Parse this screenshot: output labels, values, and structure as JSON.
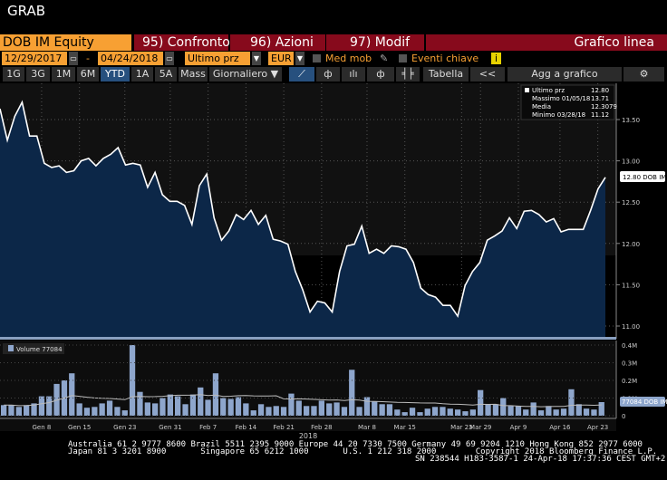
{
  "window": {
    "title": "GRAB"
  },
  "header": {
    "security": "DOB IM Equity",
    "compare": "95) Confronto",
    "actions": "96) Azioni",
    "edit": "97) Modif",
    "chart_type": "Grafico linea"
  },
  "controls": {
    "start_date": "12/29/2017",
    "dash": "-",
    "end_date": "04/24/2018",
    "field": "Ultimo prz",
    "currency": "EUR",
    "moving_avg": "Med mob",
    "key_events": "Eventi chiave",
    "info": "i"
  },
  "toolbar": {
    "periods": [
      "1G",
      "3G",
      "1M",
      "6M",
      "YTD",
      "1A",
      "5A",
      "Mass"
    ],
    "selected": "YTD",
    "frequency": "Giornaliero ▼",
    "table": "Tabella",
    "collapse": "<<",
    "add": "Agg a grafico",
    "settings": "⚙"
  },
  "legend": {
    "last_label": "Ultimo prz",
    "last": "12.80",
    "max_label": "Massimo 01/05/18",
    "max": "13.71",
    "mean_label": "Media",
    "mean": "12.3079",
    "min_label": "Minimo 03/28/18",
    "min": "11.12"
  },
  "price_tag": "12.80 DOB IM",
  "volume_legend": "Volume 77084",
  "volume_tag": "77084 DOB IM",
  "year_label": "2018",
  "footer": {
    "line1": "Australia 61 2 9777 8600 Brazil 5511 2395 9000 Europe 44 20 7330 7500 Germany 49 69 9204 1210 Hong Kong 852 2977 6000",
    "line2": "Japan 81 3 3201 8900       Singapore 65 6212 1000       U.S. 1 212 318 2000        Copyright 2018 Bloomberg Finance L.P.",
    "line3": "SN 238544 H183-3587-1 24-Apr-18 17:37:36 CEST GMT+2:00"
  },
  "colors": {
    "orange": "#f7a033",
    "red": "#870a1c",
    "fill": "#0c2748",
    "bar": "#8ea6cc"
  },
  "chart_data": [
    {
      "type": "area",
      "title": "DOB IM Equity Ultimo prz",
      "ylim": [
        10.9,
        13.9
      ],
      "yticks": [
        "11.00",
        "11.50",
        "12.00",
        "12.50",
        "13.00",
        "13.50"
      ],
      "values": [
        13.63,
        13.25,
        13.54,
        13.71,
        13.3,
        13.3,
        12.97,
        12.92,
        12.94,
        12.86,
        12.88,
        13.0,
        13.03,
        12.94,
        13.03,
        13.08,
        13.16,
        12.95,
        12.97,
        12.95,
        12.68,
        12.86,
        12.59,
        12.51,
        12.51,
        12.46,
        12.23,
        12.7,
        12.84,
        12.31,
        12.04,
        12.15,
        12.35,
        12.29,
        12.4,
        12.23,
        12.34,
        12.05,
        12.03,
        11.99,
        11.66,
        11.44,
        11.17,
        11.3,
        11.28,
        11.17,
        11.66,
        11.97,
        11.99,
        12.21,
        11.88,
        11.93,
        11.88,
        11.97,
        11.96,
        11.93,
        11.77,
        11.46,
        11.38,
        11.35,
        11.25,
        11.25,
        11.12,
        11.49,
        11.66,
        11.77,
        12.04,
        12.09,
        12.15,
        12.31,
        12.18,
        12.39,
        12.4,
        12.35,
        12.26,
        12.3,
        12.14,
        12.17,
        12.17,
        12.17,
        12.4,
        12.66,
        12.8
      ]
    },
    {
      "type": "bar",
      "title": "Volume",
      "ylim": [
        0,
        0.42
      ],
      "yticks": [
        "0",
        "0.1M",
        "0.2M",
        "0.3M",
        "0.4M"
      ],
      "unit": "M",
      "values": [
        0.06,
        0.06,
        0.05,
        0.06,
        0.07,
        0.11,
        0.11,
        0.18,
        0.2,
        0.24,
        0.07,
        0.045,
        0.05,
        0.07,
        0.085,
        0.05,
        0.03,
        0.4,
        0.135,
        0.075,
        0.07,
        0.1,
        0.12,
        0.11,
        0.065,
        0.12,
        0.16,
        0.09,
        0.24,
        0.1,
        0.095,
        0.105,
        0.07,
        0.03,
        0.065,
        0.05,
        0.055,
        0.05,
        0.125,
        0.085,
        0.055,
        0.055,
        0.085,
        0.07,
        0.075,
        0.05,
        0.26,
        0.05,
        0.105,
        0.08,
        0.065,
        0.065,
        0.035,
        0.02,
        0.045,
        0.02,
        0.04,
        0.05,
        0.05,
        0.04,
        0.035,
        0.025,
        0.035,
        0.145,
        0.065,
        0.065,
        0.1,
        0.055,
        0.055,
        0.035,
        0.075,
        0.03,
        0.055,
        0.035,
        0.04,
        0.15,
        0.065,
        0.04,
        0.035,
        0.077
      ]
    },
    {
      "type": "axis",
      "xticks": [
        {
          "label": "Gen 8",
          "index": 5.5
        },
        {
          "label": "Gen 15",
          "index": 10.5
        },
        {
          "label": "Gen 23",
          "index": 16.5
        },
        {
          "label": "Gen 31",
          "index": 22.5
        },
        {
          "label": "Feb 7",
          "index": 27.5
        },
        {
          "label": "Feb 14",
          "index": 32.5
        },
        {
          "label": "Feb 21",
          "index": 37.5
        },
        {
          "label": "Feb 28",
          "index": 42.5
        },
        {
          "label": "Mar 8",
          "index": 48.5
        },
        {
          "label": "Mar 15",
          "index": 53.5
        },
        {
          "label": "Mar 23",
          "index": 61
        },
        {
          "label": "Mar 29",
          "index": 63.5
        },
        {
          "label": "Apr 9",
          "index": 68.5
        },
        {
          "label": "Apr 16",
          "index": 74
        },
        {
          "label": "Apr 23",
          "index": 79
        }
      ]
    }
  ]
}
